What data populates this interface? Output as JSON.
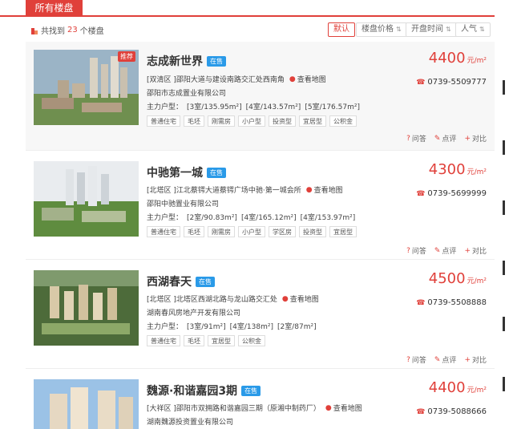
{
  "tabs": {
    "active": "所有楼盘"
  },
  "toolbar": {
    "found_prefix": "共找到",
    "found_count": "23",
    "found_suffix": "个楼盘",
    "sort": [
      {
        "label": "默认",
        "active": true
      },
      {
        "label": "楼盘价格",
        "active": false
      },
      {
        "label": "开盘时间",
        "active": false
      },
      {
        "label": "人气",
        "active": false
      }
    ]
  },
  "listings": [
    {
      "name": "志成新世界",
      "status": "在售",
      "hot": "推荐",
      "address": "[双清区 ]邵阳大道与建设南路交汇处西南角",
      "map": "查看地图",
      "developer": "邵阳市志成置业有限公司",
      "units_label": "主力户型：",
      "units": [
        "[3室/135.95m²]",
        "[4室/143.57m²]",
        "[5室/176.57m²]"
      ],
      "tags": [
        "普通住宅",
        "毛坯",
        "刚需房",
        "小户型",
        "投资型",
        "宜居型",
        "公积金"
      ],
      "price": "4400",
      "price_unit": "元/m²",
      "phone": "0739-5509777",
      "actions": {
        "ask": "问答",
        "review": "点评",
        "compare": "对比"
      }
    },
    {
      "name": "中驰第一城",
      "status": "在售",
      "address": "[北塔区 ]江北蔡锷大道蔡锷广场中驰·第一城会所",
      "map": "查看地图",
      "developer": "邵阳中驰置业有限公司",
      "units_label": "主力户型：",
      "units": [
        "[2室/90.83m²]",
        "[4室/165.12m²]",
        "[4室/153.97m²]"
      ],
      "tags": [
        "普通住宅",
        "毛坯",
        "刚需房",
        "小户型",
        "学区房",
        "投资型",
        "宜居型"
      ],
      "price": "4300",
      "price_unit": "元/m²",
      "phone": "0739-5699999",
      "actions": {
        "ask": "问答",
        "review": "点评",
        "compare": "对比"
      }
    },
    {
      "name": "西湖春天",
      "status": "在售",
      "address": "[北塔区 ]北塔区西湖北路与龙山路交汇处",
      "map": "查看地图",
      "developer": "湖南春风房地产开发有限公司",
      "units_label": "主力户型：",
      "units": [
        "[3室/91m²]",
        "[4室/138m²]",
        "[2室/87m²]"
      ],
      "tags": [
        "普通住宅",
        "毛坯",
        "宜居型",
        "公积金"
      ],
      "price": "4500",
      "price_unit": "元/m²",
      "phone": "0739-5508888",
      "actions": {
        "ask": "问答",
        "review": "点评",
        "compare": "对比"
      }
    },
    {
      "name": "魏源·和谐嘉园3期",
      "status": "在售",
      "address": "[大祥区 ]邵阳市双拥路和谐嘉园三期（原湘中制药厂）",
      "map": "查看地图",
      "developer": "湖南魏源投资置业有限公司",
      "price": "4400",
      "price_unit": "元/m²",
      "phone": "0739-5088666"
    }
  ],
  "colors": {
    "accent": "#e0403a",
    "status": "#2a9ae8"
  }
}
